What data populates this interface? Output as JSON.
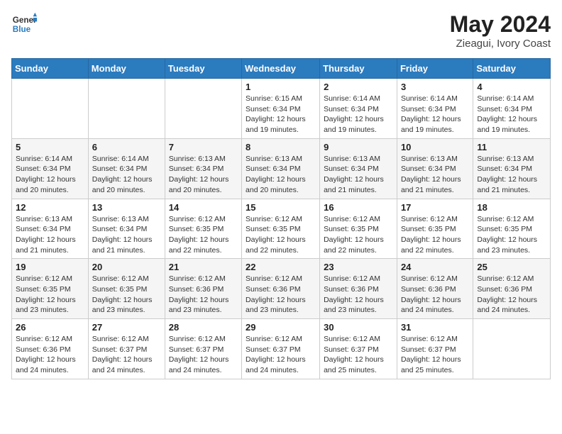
{
  "logo": {
    "line1": "General",
    "line2": "Blue"
  },
  "title": "May 2024",
  "location": "Zieagui, Ivory Coast",
  "days_of_week": [
    "Sunday",
    "Monday",
    "Tuesday",
    "Wednesday",
    "Thursday",
    "Friday",
    "Saturday"
  ],
  "weeks": [
    [
      {
        "day": "",
        "info": ""
      },
      {
        "day": "",
        "info": ""
      },
      {
        "day": "",
        "info": ""
      },
      {
        "day": "1",
        "info": "Sunrise: 6:15 AM\nSunset: 6:34 PM\nDaylight: 12 hours and 19 minutes."
      },
      {
        "day": "2",
        "info": "Sunrise: 6:14 AM\nSunset: 6:34 PM\nDaylight: 12 hours and 19 minutes."
      },
      {
        "day": "3",
        "info": "Sunrise: 6:14 AM\nSunset: 6:34 PM\nDaylight: 12 hours and 19 minutes."
      },
      {
        "day": "4",
        "info": "Sunrise: 6:14 AM\nSunset: 6:34 PM\nDaylight: 12 hours and 19 minutes."
      }
    ],
    [
      {
        "day": "5",
        "info": "Sunrise: 6:14 AM\nSunset: 6:34 PM\nDaylight: 12 hours and 20 minutes."
      },
      {
        "day": "6",
        "info": "Sunrise: 6:14 AM\nSunset: 6:34 PM\nDaylight: 12 hours and 20 minutes."
      },
      {
        "day": "7",
        "info": "Sunrise: 6:13 AM\nSunset: 6:34 PM\nDaylight: 12 hours and 20 minutes."
      },
      {
        "day": "8",
        "info": "Sunrise: 6:13 AM\nSunset: 6:34 PM\nDaylight: 12 hours and 20 minutes."
      },
      {
        "day": "9",
        "info": "Sunrise: 6:13 AM\nSunset: 6:34 PM\nDaylight: 12 hours and 21 minutes."
      },
      {
        "day": "10",
        "info": "Sunrise: 6:13 AM\nSunset: 6:34 PM\nDaylight: 12 hours and 21 minutes."
      },
      {
        "day": "11",
        "info": "Sunrise: 6:13 AM\nSunset: 6:34 PM\nDaylight: 12 hours and 21 minutes."
      }
    ],
    [
      {
        "day": "12",
        "info": "Sunrise: 6:13 AM\nSunset: 6:34 PM\nDaylight: 12 hours and 21 minutes."
      },
      {
        "day": "13",
        "info": "Sunrise: 6:13 AM\nSunset: 6:34 PM\nDaylight: 12 hours and 21 minutes."
      },
      {
        "day": "14",
        "info": "Sunrise: 6:12 AM\nSunset: 6:35 PM\nDaylight: 12 hours and 22 minutes."
      },
      {
        "day": "15",
        "info": "Sunrise: 6:12 AM\nSunset: 6:35 PM\nDaylight: 12 hours and 22 minutes."
      },
      {
        "day": "16",
        "info": "Sunrise: 6:12 AM\nSunset: 6:35 PM\nDaylight: 12 hours and 22 minutes."
      },
      {
        "day": "17",
        "info": "Sunrise: 6:12 AM\nSunset: 6:35 PM\nDaylight: 12 hours and 22 minutes."
      },
      {
        "day": "18",
        "info": "Sunrise: 6:12 AM\nSunset: 6:35 PM\nDaylight: 12 hours and 23 minutes."
      }
    ],
    [
      {
        "day": "19",
        "info": "Sunrise: 6:12 AM\nSunset: 6:35 PM\nDaylight: 12 hours and 23 minutes."
      },
      {
        "day": "20",
        "info": "Sunrise: 6:12 AM\nSunset: 6:35 PM\nDaylight: 12 hours and 23 minutes."
      },
      {
        "day": "21",
        "info": "Sunrise: 6:12 AM\nSunset: 6:36 PM\nDaylight: 12 hours and 23 minutes."
      },
      {
        "day": "22",
        "info": "Sunrise: 6:12 AM\nSunset: 6:36 PM\nDaylight: 12 hours and 23 minutes."
      },
      {
        "day": "23",
        "info": "Sunrise: 6:12 AM\nSunset: 6:36 PM\nDaylight: 12 hours and 23 minutes."
      },
      {
        "day": "24",
        "info": "Sunrise: 6:12 AM\nSunset: 6:36 PM\nDaylight: 12 hours and 24 minutes."
      },
      {
        "day": "25",
        "info": "Sunrise: 6:12 AM\nSunset: 6:36 PM\nDaylight: 12 hours and 24 minutes."
      }
    ],
    [
      {
        "day": "26",
        "info": "Sunrise: 6:12 AM\nSunset: 6:36 PM\nDaylight: 12 hours and 24 minutes."
      },
      {
        "day": "27",
        "info": "Sunrise: 6:12 AM\nSunset: 6:37 PM\nDaylight: 12 hours and 24 minutes."
      },
      {
        "day": "28",
        "info": "Sunrise: 6:12 AM\nSunset: 6:37 PM\nDaylight: 12 hours and 24 minutes."
      },
      {
        "day": "29",
        "info": "Sunrise: 6:12 AM\nSunset: 6:37 PM\nDaylight: 12 hours and 24 minutes."
      },
      {
        "day": "30",
        "info": "Sunrise: 6:12 AM\nSunset: 6:37 PM\nDaylight: 12 hours and 25 minutes."
      },
      {
        "day": "31",
        "info": "Sunrise: 6:12 AM\nSunset: 6:37 PM\nDaylight: 12 hours and 25 minutes."
      },
      {
        "day": "",
        "info": ""
      }
    ]
  ]
}
